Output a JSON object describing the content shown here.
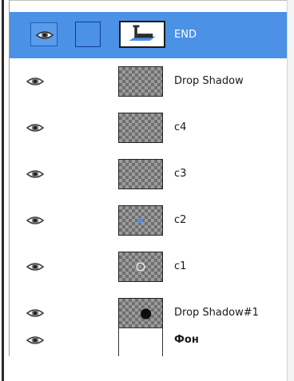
{
  "layers_panel": {
    "layers": [
      {
        "name": "END",
        "visible": true,
        "selected": true,
        "linked_chain": true,
        "thumbnail": "text-layer-icon"
      },
      {
        "name": "Drop Shadow",
        "visible": true,
        "selected": false,
        "thumbnail": "transparent-thumbnail"
      },
      {
        "name": "c4",
        "visible": true,
        "selected": false,
        "thumbnail": "transparent-thumbnail"
      },
      {
        "name": "c3",
        "visible": true,
        "selected": false,
        "thumbnail": "transparent-thumbnail"
      },
      {
        "name": "c2",
        "visible": true,
        "selected": false,
        "thumbnail": "transparent-thumbnail"
      },
      {
        "name": "c1",
        "visible": true,
        "selected": false,
        "thumbnail": "transparent-thumbnail"
      },
      {
        "name": "Drop Shadow#1",
        "visible": true,
        "selected": false,
        "thumbnail": "transparent-thumbnail"
      },
      {
        "name": "Фон",
        "visible": true,
        "selected": false,
        "thumbnail": "white-thumbnail"
      }
    ]
  },
  "colors": {
    "selection": "#4b91e6",
    "selected_text": "#ffffff",
    "text": "#1a1a1a",
    "checker_dark": "#6f6f6f",
    "checker_light": "#9c9c9c"
  }
}
